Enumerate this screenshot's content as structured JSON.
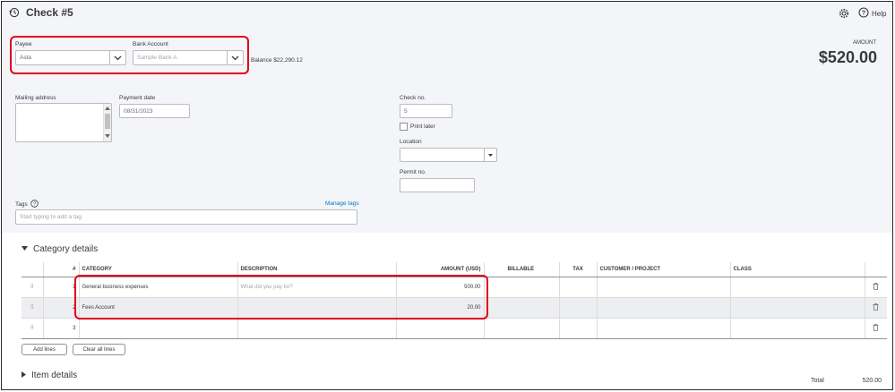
{
  "header": {
    "title": "Check #5",
    "help_label": "Help"
  },
  "payee": {
    "label": "Payee",
    "value": "Asta"
  },
  "bank_account": {
    "label": "Bank Account",
    "value": "Sample Bank A"
  },
  "balance": {
    "text": "Balance $22,290.12"
  },
  "amount": {
    "label": "AMOUNT",
    "value": "$520.00"
  },
  "mailing_address": {
    "label": "Mailing address"
  },
  "payment_date": {
    "label": "Payment date",
    "value": "08/31/2023"
  },
  "check_no": {
    "label": "Check no.",
    "value": "5"
  },
  "print_later": {
    "label": "Print later",
    "checked": false
  },
  "location": {
    "label": "Location",
    "value": ""
  },
  "permit_no": {
    "label": "Permit no.",
    "value": ""
  },
  "tags": {
    "label": "Tags",
    "manage_label": "Manage tags",
    "placeholder": "Start typing to add a tag"
  },
  "category_details": {
    "title": "Category details",
    "columns": [
      "#",
      "CATEGORY",
      "DESCRIPTION",
      "AMOUNT (USD)",
      "BILLABLE",
      "TAX",
      "CUSTOMER / PROJECT",
      "CLASS"
    ],
    "rows": [
      {
        "num": "1",
        "category": "General business expenses",
        "description": "",
        "description_placeholder": "What did you pay for?",
        "amount": "500.00"
      },
      {
        "num": "2",
        "category": "Fees Account",
        "description": "",
        "description_placeholder": "",
        "amount": "20.00"
      },
      {
        "num": "3",
        "category": "",
        "description": "",
        "description_placeholder": "",
        "amount": ""
      }
    ],
    "add_lines_label": "Add lines",
    "clear_lines_label": "Clear all lines"
  },
  "item_details": {
    "title": "Item details"
  },
  "total": {
    "label": "Total",
    "value": "520.00"
  },
  "colors": {
    "highlight": "#e0001b",
    "background": "#f4f5f8",
    "border": "#b9bbc0"
  },
  "icons": [
    "history-icon",
    "gear-icon",
    "help-icon",
    "chevron-down-icon",
    "scroll-up-icon",
    "scroll-down-icon",
    "caret-down-icon",
    "collapse-caret-icon",
    "expand-caret-icon",
    "drag-handle-icon",
    "trash-icon"
  ]
}
